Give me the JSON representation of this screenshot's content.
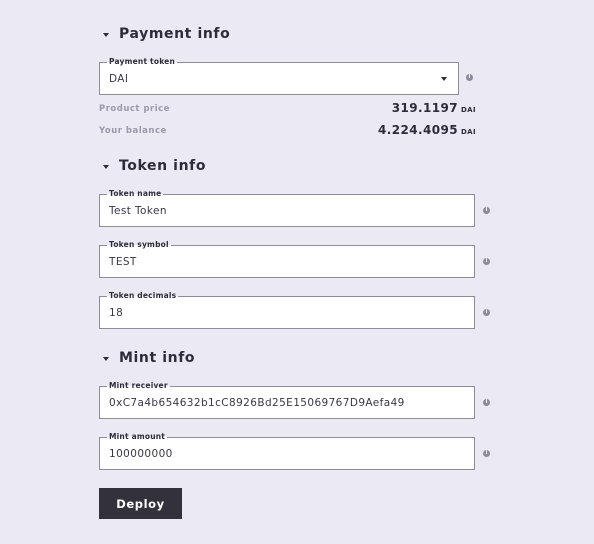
{
  "payment": {
    "title": "Payment info",
    "token_label": "Payment token",
    "token_value": "DAI",
    "price_label": "Product price",
    "price_value": "319.1197",
    "price_unit": "DAI",
    "balance_label": "Your balance",
    "balance_value": "4.224.4095",
    "balance_unit": "DAI"
  },
  "token": {
    "title": "Token info",
    "name_label": "Token name",
    "name_value": "Test Token",
    "symbol_label": "Token symbol",
    "symbol_value": "TEST",
    "decimals_label": "Token decimals",
    "decimals_value": "18"
  },
  "mint": {
    "title": "Mint info",
    "receiver_label": "Mint receiver",
    "receiver_value": "0xC7a4b654632b1cC8926Bd25E15069767D9Aefa49",
    "amount_label": "Mint amount",
    "amount_value": "100000000"
  },
  "actions": {
    "deploy_label": "Deploy"
  },
  "icons": {
    "section_toggle": "caret-down-icon",
    "field_info": "info-icon",
    "select_arrow": "chevron-down-icon"
  },
  "colors": {
    "background": "#ebe9f4",
    "text": "#2e2c38",
    "muted": "#9c99a8",
    "button": "#33313c"
  }
}
